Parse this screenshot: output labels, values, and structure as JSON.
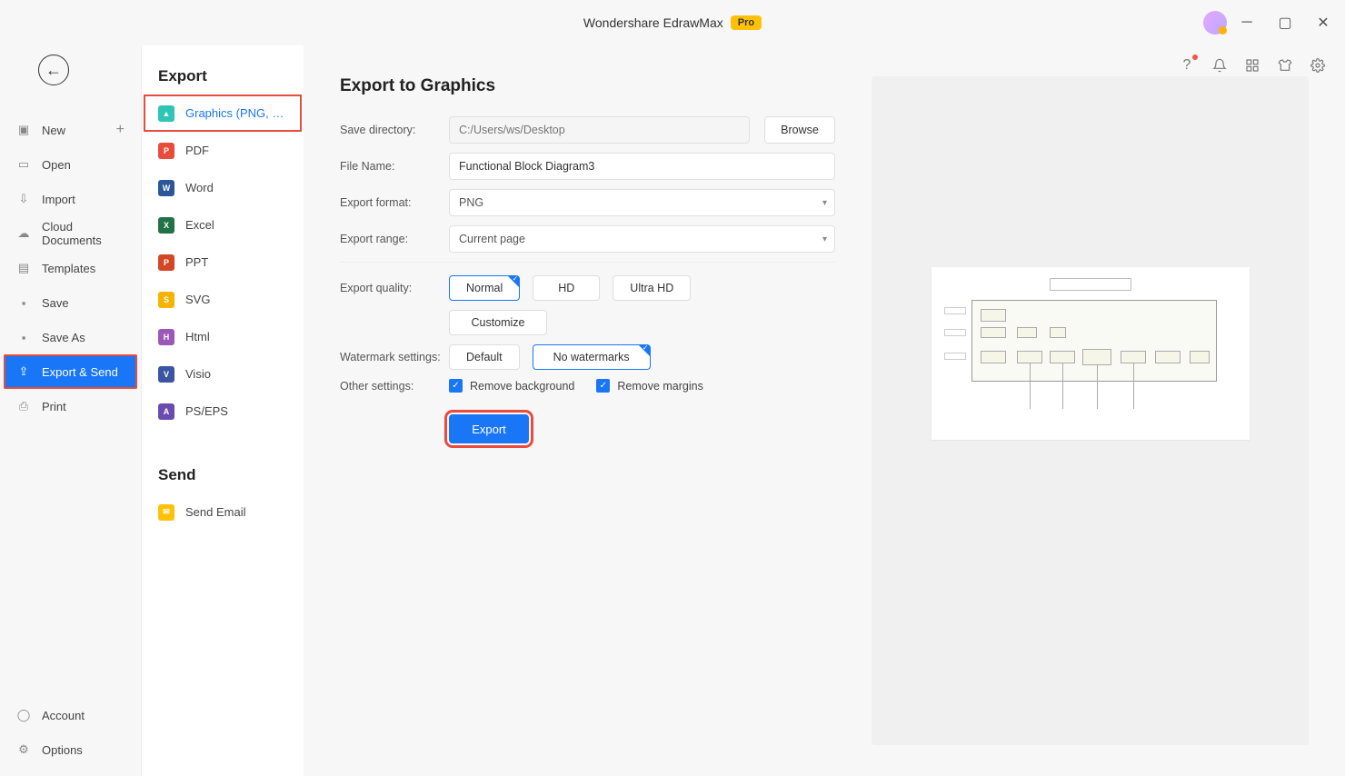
{
  "app": {
    "title": "Wondershare EdrawMax",
    "pro_badge": "Pro"
  },
  "nav": {
    "new": "New",
    "open": "Open",
    "import": "Import",
    "cloud": "Cloud Documents",
    "templates": "Templates",
    "save": "Save",
    "saveas": "Save As",
    "exportsend": "Export & Send",
    "print": "Print",
    "account": "Account",
    "options": "Options"
  },
  "secondary": {
    "export_heading": "Export",
    "send_heading": "Send",
    "formats": {
      "graphics": "Graphics (PNG, JPG e...",
      "pdf": "PDF",
      "word": "Word",
      "excel": "Excel",
      "ppt": "PPT",
      "svg": "SVG",
      "html": "Html",
      "visio": "Visio",
      "pseps": "PS/EPS"
    },
    "send_email": "Send Email"
  },
  "form": {
    "title": "Export to Graphics",
    "save_dir_label": "Save directory:",
    "save_dir_placeholder": "C:/Users/ws/Desktop",
    "browse": "Browse",
    "filename_label": "File Name:",
    "filename_value": "Functional Block Diagram3",
    "format_label": "Export format:",
    "format_value": "PNG",
    "range_label": "Export range:",
    "range_value": "Current page",
    "quality_label": "Export quality:",
    "q_normal": "Normal",
    "q_hd": "HD",
    "q_ultra": "Ultra HD",
    "q_custom": "Customize",
    "watermark_label": "Watermark settings:",
    "wm_default": "Default",
    "wm_none": "No watermarks",
    "other_label": "Other settings:",
    "chk_bg": "Remove background",
    "chk_margin": "Remove margins",
    "export_btn": "Export"
  }
}
